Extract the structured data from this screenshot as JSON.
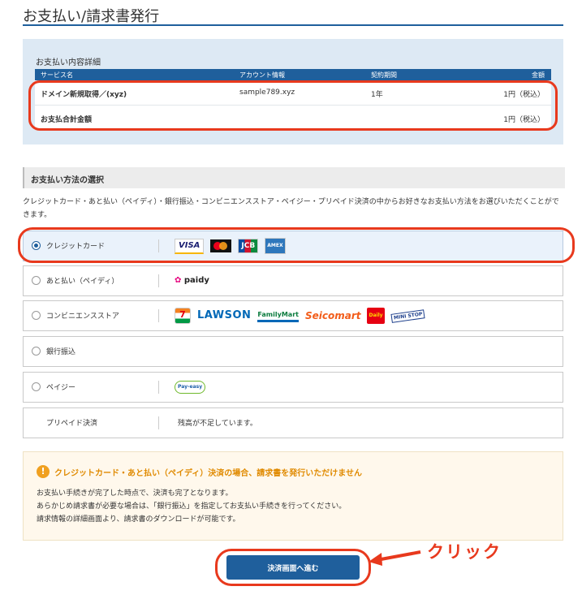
{
  "page": {
    "title": "お支払い/請求書発行"
  },
  "details": {
    "heading": "お支払い内容詳細",
    "columns": [
      "サービス名",
      "アカウント情報",
      "契約期間",
      "金額"
    ],
    "row": {
      "service": "ドメイン新規取得／(xyz)",
      "account": "sample789.xyz",
      "term": "1年",
      "amount": "1円（税込）"
    },
    "total": {
      "label": "お支払合計金額",
      "amount": "1円（税込）"
    }
  },
  "method": {
    "heading": "お支払い方法の選択",
    "description": "クレジットカード・あと払い（ペイディ）・銀行振込・コンビニエンスストア・ペイジー・プリペイド決済の中からお好きなお支払い方法をお選びいただくことができます。",
    "options": [
      {
        "label": "クレジットカード",
        "selected": true,
        "logos": [
          "VISA",
          "Mastercard",
          "JCB",
          "AMEX"
        ]
      },
      {
        "label": "あと払い（ペイディ）",
        "selected": false,
        "logos": [
          "paidy"
        ]
      },
      {
        "label": "コンビニエンスストア",
        "selected": false,
        "logos": [
          "7",
          "LAWSON",
          "FamilyMart",
          "Seicomart",
          "Daily",
          "MINI STOP"
        ]
      },
      {
        "label": "銀行振込",
        "selected": false,
        "logos": []
      },
      {
        "label": "ペイジー",
        "selected": false,
        "logos": [
          "Pay-easy"
        ]
      },
      {
        "label": "プリペイド決済",
        "note": "残高が不足しています。"
      }
    ]
  },
  "notice": {
    "title": "クレジットカード・あと払い（ペイディ）決済の場合、請求書を発行いただけません",
    "lines": [
      "お支払い手続きが完了した時点で、決済も完了となります。",
      "あらかじめ請求書が必要な場合は、「銀行振込」を指定してお支払い手続きを行ってください。",
      "請求情報の詳細画面より、請求書のダウンロードが可能です。"
    ]
  },
  "proceed_label": "決済画面へ進む",
  "annotation": "クリック",
  "colors": {
    "primary": "#1f5f9c",
    "highlight": "#e8391d",
    "warning": "#e08a00"
  }
}
